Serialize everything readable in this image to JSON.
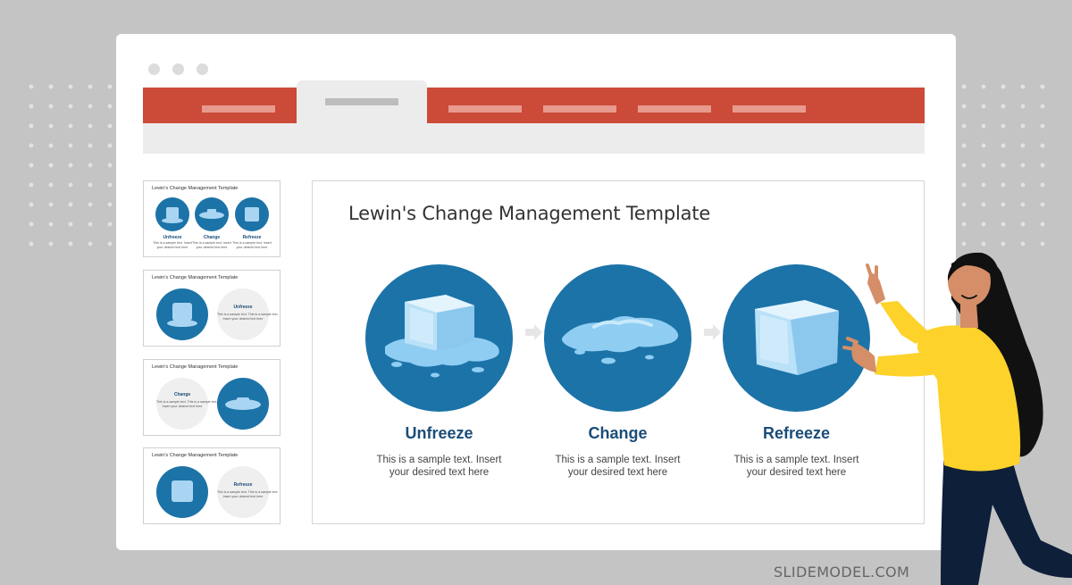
{
  "slide": {
    "title": "Lewin's Change Management Template",
    "stages": [
      {
        "label": "Unfreeze",
        "text_line1": "This is a sample text. Insert",
        "text_line2": "your desired text here",
        "icon": "ice-cube-melting-icon"
      },
      {
        "label": "Change",
        "text_line1": "This is a sample text. Insert",
        "text_line2": "your desired text here",
        "icon": "water-puddle-icon"
      },
      {
        "label": "Refreeze",
        "text_line1": "This is a sample text. Insert",
        "text_line2": "your desired text here",
        "icon": "ice-cube-icon"
      }
    ]
  },
  "thumbnails": [
    {
      "title": "Lewin's Change Management Template",
      "labels": [
        "Unfreeze",
        "Change",
        "Refreeze"
      ],
      "body1": "This is a sample text. Insert",
      "body2": "your desired text here"
    },
    {
      "title": "Lewin's Change Management Template",
      "label": "Unfreeze",
      "body1": "This is a sample text. This is a sample text.",
      "body2": "Insert your desired text here"
    },
    {
      "title": "Lewin's Change Management Template",
      "label": "Change",
      "body1": "This is a sample text. This is a sample text.",
      "body2": "Insert your desired text here"
    },
    {
      "title": "Lewin's Change Management Template",
      "label": "Refreeze",
      "body1": "This is a sample text. This is a sample text.",
      "body2": "Insert your desired text here"
    }
  ],
  "brand": "SLIDEMODEL.COM",
  "colors": {
    "ribbon": "#cc4a38",
    "circle": "#1c73a8",
    "label": "#1b4d78",
    "shirt": "#fdd22a"
  }
}
